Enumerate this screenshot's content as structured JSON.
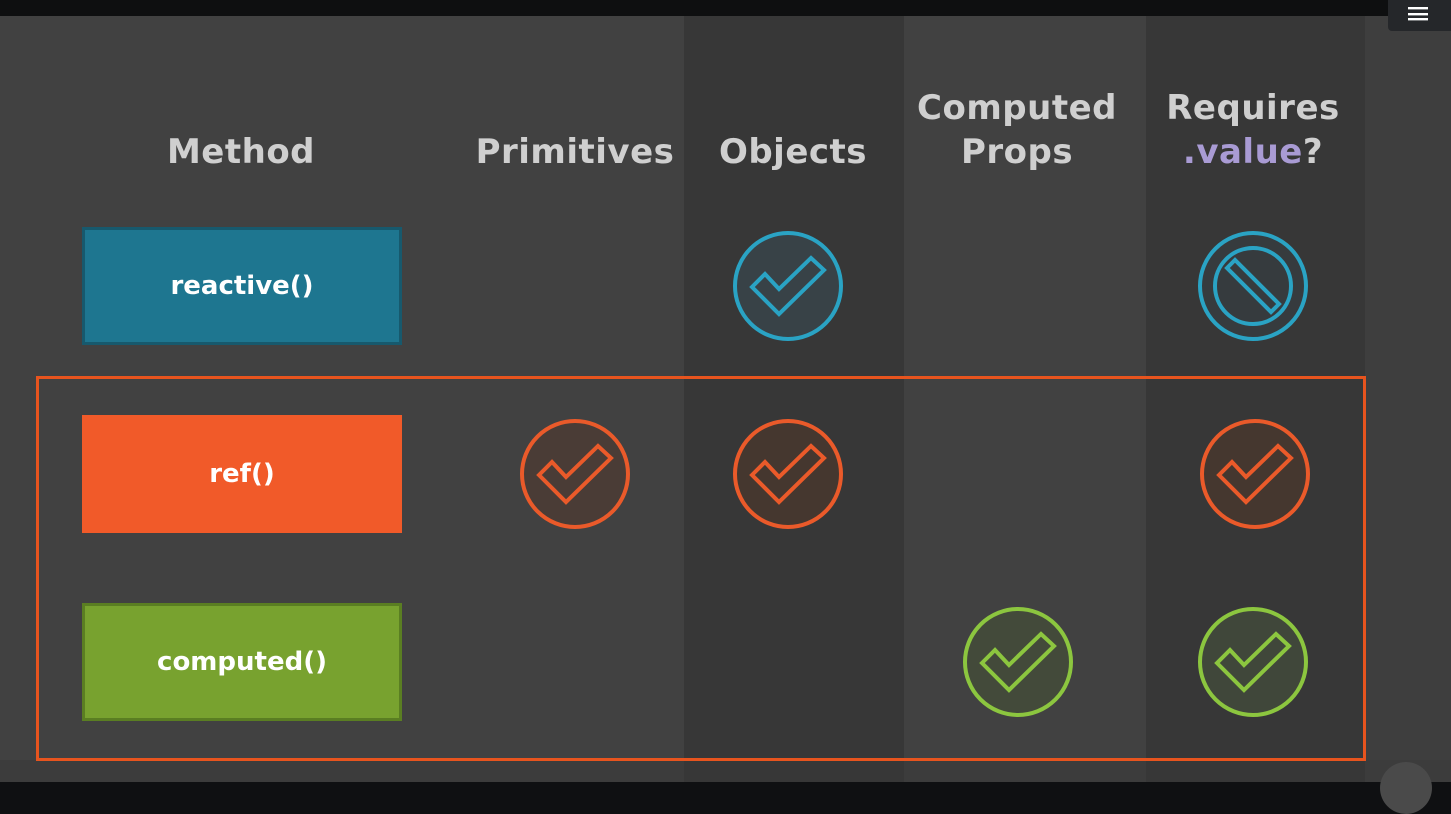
{
  "colors": {
    "reactive": "#1e7690",
    "ref": "#f15a29",
    "computed": "#78a22f",
    "value_accent": "#a99bd4",
    "highlight_border": "#e7541e",
    "reactive_icon": "#2aa3c4",
    "ref_icon": "#ea5a2a",
    "computed_icon": "#8cc63f"
  },
  "player": {
    "menu_icon": "menu-icon"
  },
  "table": {
    "headers": {
      "method": "Method",
      "primitives": "Primitives",
      "objects": "Objects",
      "computed_props_line1": "Computed",
      "computed_props_line2": "Props",
      "requires_value_line1": "Requires",
      "requires_value_accent": ".value",
      "requires_value_suffix": "?"
    },
    "rows": [
      {
        "method": "reactive()",
        "primitives": "none",
        "objects": "check-icon",
        "computed_props": "none",
        "requires_value": "no-icon"
      },
      {
        "method": "ref()",
        "primitives": "check-icon",
        "objects": "check-icon",
        "computed_props": "none",
        "requires_value": "check-icon"
      },
      {
        "method": "computed()",
        "primitives": "none",
        "objects": "none",
        "computed_props": "check-icon",
        "requires_value": "check-icon"
      }
    ]
  }
}
